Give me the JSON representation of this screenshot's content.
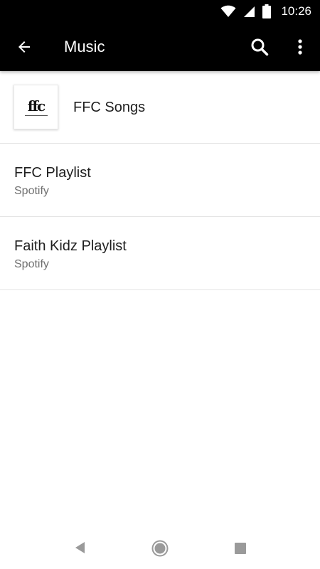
{
  "status_bar": {
    "time": "10:26",
    "icons": [
      "wifi-icon",
      "cellular-signal-icon",
      "battery-icon"
    ]
  },
  "app_bar": {
    "title": "Music",
    "back_icon": "arrow-back-icon",
    "search_icon": "search-icon",
    "more_icon": "more-vert-icon",
    "background_color": "#000000"
  },
  "list": {
    "items": [
      {
        "title": "FFC Songs",
        "thumbnail_text": "ffc"
      },
      {
        "title": "FFC Playlist",
        "subtitle": "Spotify"
      },
      {
        "title": "Faith Kidz Playlist",
        "subtitle": "Spotify"
      }
    ]
  },
  "nav_bar": {
    "icons": [
      "nav-back-icon",
      "nav-home-icon",
      "nav-recents-icon"
    ]
  }
}
